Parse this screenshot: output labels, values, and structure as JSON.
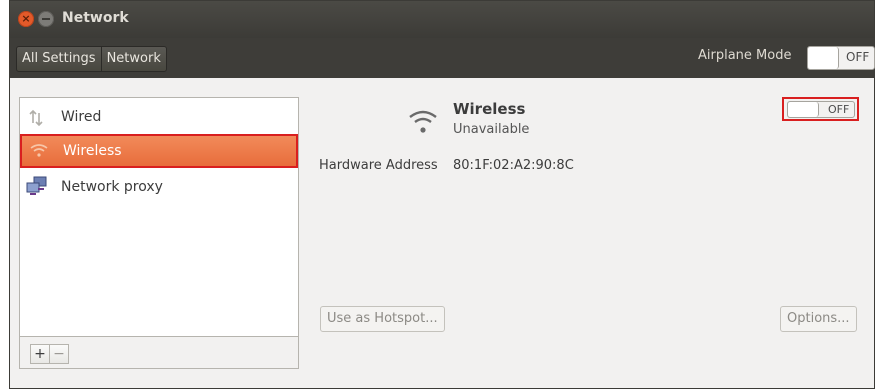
{
  "window": {
    "title": "Network"
  },
  "toolbar": {
    "breadcrumbs": [
      "All Settings",
      "Network"
    ],
    "airplane_label": "Airplane Mode",
    "airplane_state": "OFF"
  },
  "sidebar": {
    "items": [
      {
        "label": "Wired",
        "icon": "wired-arrows-icon",
        "selected": false
      },
      {
        "label": "Wireless",
        "icon": "wifi-icon",
        "selected": true
      },
      {
        "label": "Network proxy",
        "icon": "network-proxy-icon",
        "selected": false
      }
    ],
    "add_label": "+",
    "remove_label": "−"
  },
  "detail": {
    "title": "Wireless",
    "status": "Unavailable",
    "toggle_state": "OFF",
    "hw_label": "Hardware Address",
    "hw_value": "80:1F:02:A2:90:8C",
    "hotspot_label": "Use as Hotspot...",
    "options_label": "Options..."
  },
  "colors": {
    "selection": "#e86d3b",
    "highlight_border": "#d91f1f",
    "titlebar": "#3c3b37"
  }
}
